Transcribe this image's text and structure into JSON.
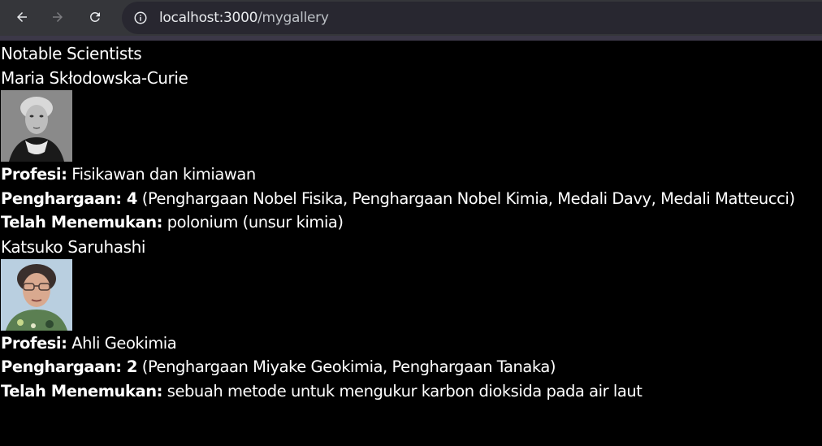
{
  "browser": {
    "url_host": "localhost:3000",
    "url_path": "/mygallery"
  },
  "page": {
    "title": "Notable Scientists"
  },
  "scientists": [
    {
      "name": "Maria Skłodowska-Curie",
      "profession_label": "Profesi:",
      "profession": "Fisikawan dan kimiawan",
      "awards_label": "Penghargaan: 4",
      "awards": "(Penghargaan Nobel Fisika, Penghargaan Nobel Kimia, Medali Davy, Medali Matteucci)",
      "discovered_label": "Telah Menemukan:",
      "discovered": "polonium (unsur kimia)"
    },
    {
      "name": "Katsuko Saruhashi",
      "profession_label": "Profesi:",
      "profession": "Ahli Geokimia",
      "awards_label": "Penghargaan: 2",
      "awards": "(Penghargaan Miyake Geokimia, Penghargaan Tanaka)",
      "discovered_label": "Telah Menemukan:",
      "discovered": "sebuah metode untuk mengukur karbon dioksida pada air laut"
    }
  ]
}
